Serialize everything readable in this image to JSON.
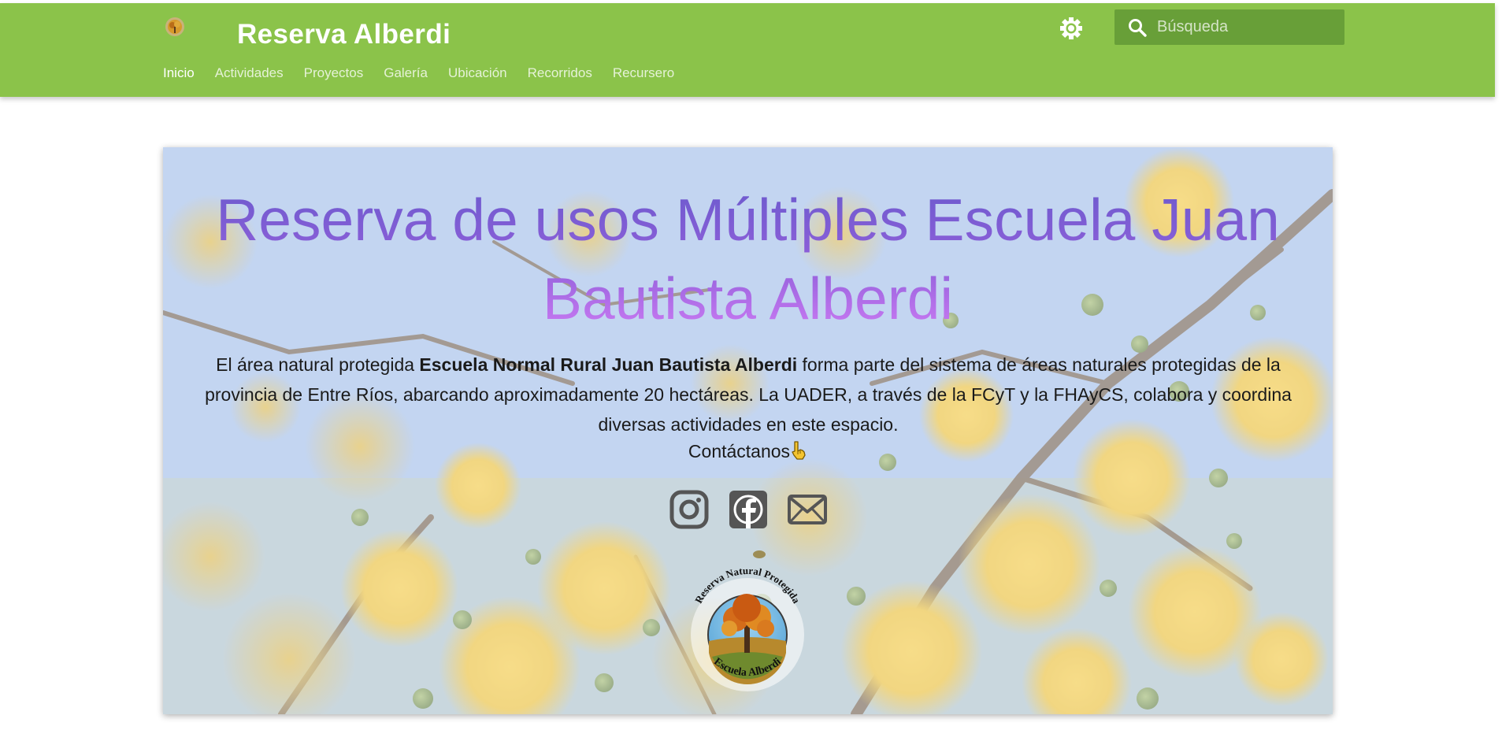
{
  "header": {
    "title": "Reserva Alberdi",
    "search_placeholder": "Búsqueda",
    "logo_icon": "tree-logo-icon",
    "theme_icon": "brightness-icon",
    "search_icon": "search-icon",
    "background_color": "#8bc34a"
  },
  "nav": [
    {
      "label": "Inicio"
    },
    {
      "label": "Actividades"
    },
    {
      "label": "Proyectos"
    },
    {
      "label": "Galería"
    },
    {
      "label": "Ubicación"
    },
    {
      "label": "Recorridos"
    },
    {
      "label": "Recursero"
    }
  ],
  "hero": {
    "title": "Reserva de usos Múltiples Escuela Juan Bautista Alberdi",
    "text_before": "El área natural protegida ",
    "text_bold": "Escuela Normal Rural Juan Bautista Alberdi",
    "text_after": " forma parte del sistema de áreas naturales protegidas de la provincia de Entre Ríos, abarcando aproximadamente 20 hectáreas. La UADER, a través de la FCyT y la FHAyCS, colabora y coordina diversas actividades en este espacio.",
    "contact_label": "Contáctanos",
    "contact_icon": "pointing-down-hand-icon",
    "social_icons": [
      "instagram-icon",
      "facebook-icon",
      "mail-icon"
    ],
    "seal": {
      "top_text": "Reserva Natural Protegida",
      "bottom_text": "Escuela Alberdi"
    },
    "title_gradient": [
      "#6a5acd",
      "#cf7cf5"
    ]
  }
}
